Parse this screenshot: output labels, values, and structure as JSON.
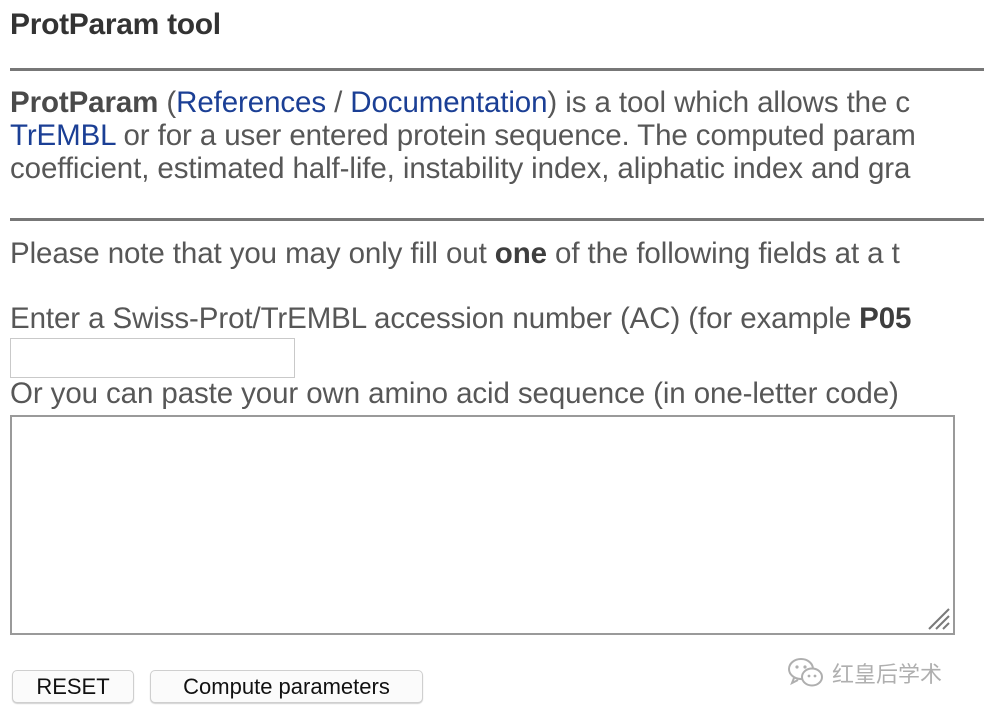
{
  "page": {
    "title": "ProtParam tool"
  },
  "intro": {
    "tool_name": "ProtParam",
    "open_paren": " (",
    "references_link": "References",
    "slash": " / ",
    "documentation_link": "Documentation",
    "line1_rest": ") is a tool which allows the c",
    "trembl_link": "TrEMBL",
    "line2_rest": " or for a user entered protein sequence. The computed param",
    "line3": "coefficient, estimated half-life, instability index, aliphatic index and gra"
  },
  "note": {
    "before": "Please note that you may only fill out ",
    "bold": "one",
    "after": " of the following fields at a t"
  },
  "accession": {
    "label_before": "Enter a Swiss-Prot/TrEMBL accession number (AC) (for example ",
    "label_bold": "P05",
    "value": "",
    "placeholder": ""
  },
  "sequence": {
    "label": "Or you can paste your own amino acid sequence (in one-letter code)",
    "value": ""
  },
  "buttons": {
    "reset": "RESET",
    "compute": "Compute parameters"
  },
  "watermark": {
    "icon": "wechat-icon",
    "text": "红皇后学术"
  }
}
